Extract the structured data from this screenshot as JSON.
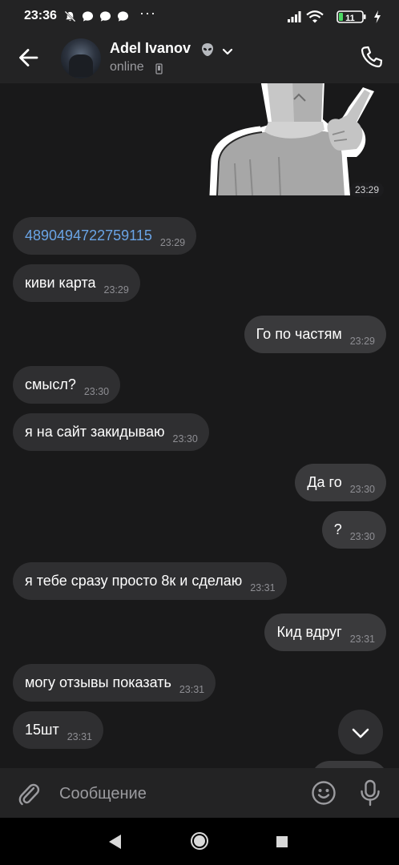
{
  "status_bar": {
    "time": "23:36",
    "icons": [
      "dnd-icon",
      "chat-bubble-icon",
      "chat-bubble-icon",
      "chat-bubble-icon",
      "more-dots-icon",
      "signal-icon",
      "wifi-icon",
      "battery-icon",
      "charging-icon"
    ],
    "more": "···",
    "battery_level": "11"
  },
  "header": {
    "contact_name": "Adel Ivanov",
    "status": "online",
    "icons": [
      "back-arrow-icon",
      "alien-icon",
      "chevron-down-icon",
      "mobile-icon",
      "phone-icon"
    ]
  },
  "messages": [
    {
      "direction": "out",
      "type": "sticker",
      "time": "23:29"
    },
    {
      "direction": "in",
      "text": "4890494722759115",
      "time": "23:29",
      "is_link": true
    },
    {
      "direction": "in",
      "text": "киви карта",
      "time": "23:29"
    },
    {
      "direction": "out",
      "text": "Го по частям",
      "time": "23:29"
    },
    {
      "direction": "in",
      "text": "смысл?",
      "time": "23:30"
    },
    {
      "direction": "in",
      "text": "я на сайт закидываю",
      "time": "23:30"
    },
    {
      "direction": "out",
      "text": "Да го",
      "time": "23:30"
    },
    {
      "direction": "out",
      "text": "?",
      "time": "23:30"
    },
    {
      "direction": "in",
      "text": "я тебе сразу просто 8к и сделаю",
      "time": "23:31"
    },
    {
      "direction": "out",
      "text": "Кид вдруг",
      "time": "23:31"
    },
    {
      "direction": "in",
      "text": "могу отзывы показать",
      "time": "23:31"
    },
    {
      "direction": "in",
      "text": "15шт",
      "time": "23:31"
    }
  ],
  "input": {
    "placeholder": "Сообщение",
    "value": ""
  },
  "colors": {
    "background": "#19191a",
    "bar": "#232324",
    "bubble_in": "#2f2f31",
    "bubble_out": "#3a3a3c",
    "link": "#6aa4e6",
    "time": "#8e8e93"
  }
}
